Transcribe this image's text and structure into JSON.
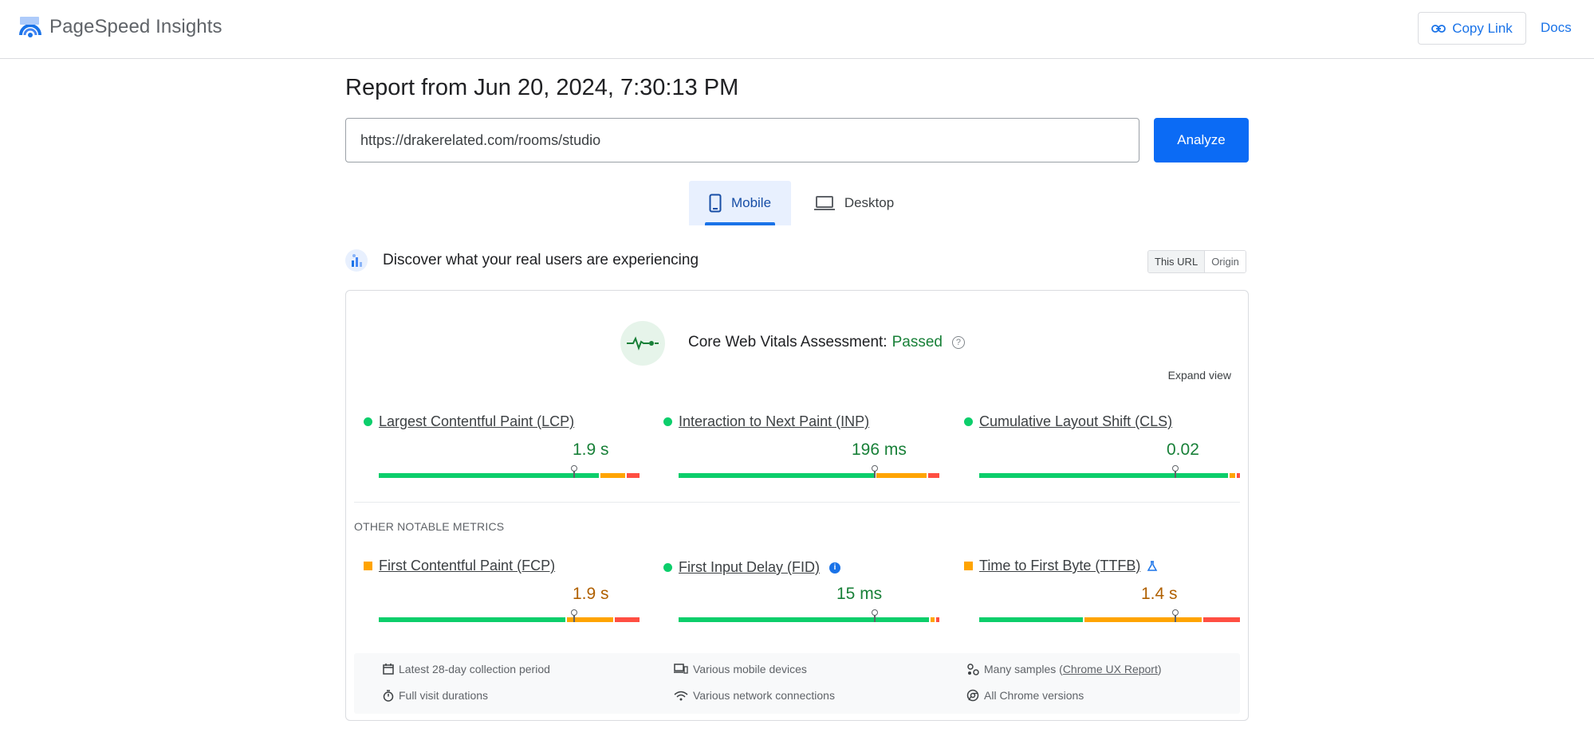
{
  "header": {
    "app_name": "PageSpeed Insights",
    "logo_icon": "pagespeed-logo-icon",
    "copy_link_label": "Copy Link",
    "copy_link_icon": "link-icon",
    "docs_label": "Docs"
  },
  "report": {
    "title": "Report from Jun 20, 2024, 7:30:13 PM",
    "url_value": "https://drakerelated.com/rooms/studio",
    "analyze_label": "Analyze"
  },
  "tabs": [
    {
      "label": "Mobile",
      "icon": "smartphone-icon",
      "active": true
    },
    {
      "label": "Desktop",
      "icon": "laptop-icon",
      "active": false
    }
  ],
  "field": {
    "heading": "Discover what your real users are experiencing",
    "toggle": [
      "This URL",
      "Origin"
    ],
    "assessment_label": "Core Web Vitals Assessment:",
    "assessment_status": "Passed",
    "expand_label": "Expand view",
    "other_title": "OTHER NOTABLE METRICS",
    "core_metrics": [
      {
        "name": "Largest Contentful Paint (LCP)",
        "value": "1.9 s",
        "status": "good"
      },
      {
        "name": "Interaction to Next Paint (INP)",
        "value": "196 ms",
        "status": "good"
      },
      {
        "name": "Cumulative Layout Shift (CLS)",
        "value": "0.02",
        "status": "good"
      }
    ],
    "other_metrics": [
      {
        "name": "First Contentful Paint (FCP)",
        "value": "1.9 s",
        "status": "needs-improvement"
      },
      {
        "name": "First Input Delay (FID)",
        "value": "15 ms",
        "status": "good"
      },
      {
        "name": "Time to First Byte (TTFB)",
        "value": "1.4 s",
        "status": "needs-improvement"
      }
    ],
    "footer": {
      "collection_period": "Latest 28-day collection period",
      "devices": "Various mobile devices",
      "samples_prefix": "Many samples (",
      "samples_link": "Chrome UX Report",
      "samples_suffix": ")",
      "durations": "Full visit durations",
      "network": "Various network connections",
      "versions": "All Chrome versions"
    }
  },
  "colors": {
    "good": "#0cce6b",
    "needs_improvement": "#ffa400",
    "poor": "#ff4e42",
    "accent": "#1a73e8",
    "analyze_button": "#0b6bf5"
  }
}
